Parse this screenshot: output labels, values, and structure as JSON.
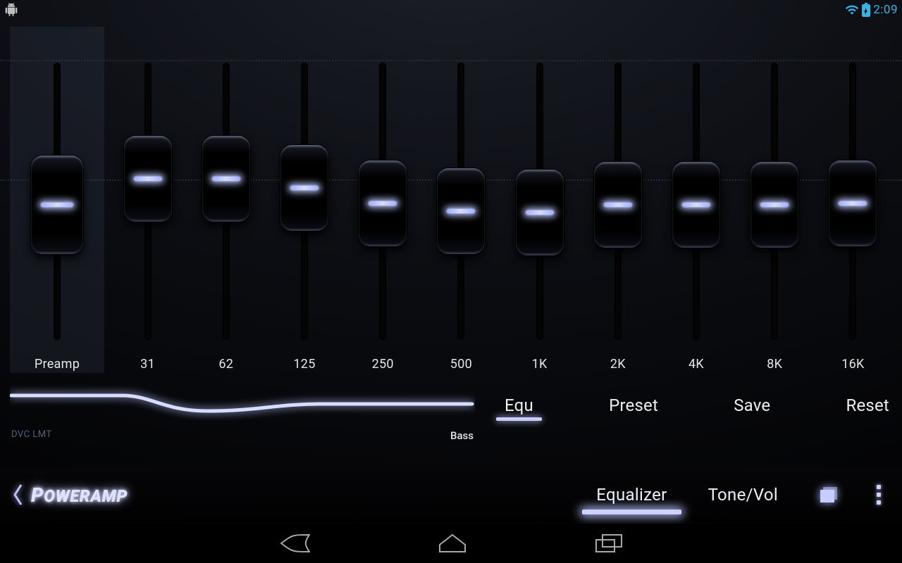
{
  "status": {
    "time": "2:09"
  },
  "eq": {
    "preamp_label": "Preamp",
    "bands": [
      {
        "label": "Preamp",
        "v": 0.52,
        "preamp": true
      },
      {
        "label": "31",
        "v": 0.38
      },
      {
        "label": "62",
        "v": 0.38
      },
      {
        "label": "125",
        "v": 0.43
      },
      {
        "label": "250",
        "v": 0.51
      },
      {
        "label": "500",
        "v": 0.55
      },
      {
        "label": "1K",
        "v": 0.56
      },
      {
        "label": "2K",
        "v": 0.52
      },
      {
        "label": "4K",
        "v": 0.52
      },
      {
        "label": "8K",
        "v": 0.52
      },
      {
        "label": "16K",
        "v": 0.51
      }
    ]
  },
  "curve": {
    "dvc": "DVC LMT",
    "bass": "Bass"
  },
  "actions": {
    "equ": "Equ",
    "preset": "Preset",
    "save": "Save",
    "reset": "Reset"
  },
  "appbar": {
    "logo": "POWERAMP",
    "tab_eq": "Equalizer",
    "tab_tone": "Tone/Vol"
  }
}
